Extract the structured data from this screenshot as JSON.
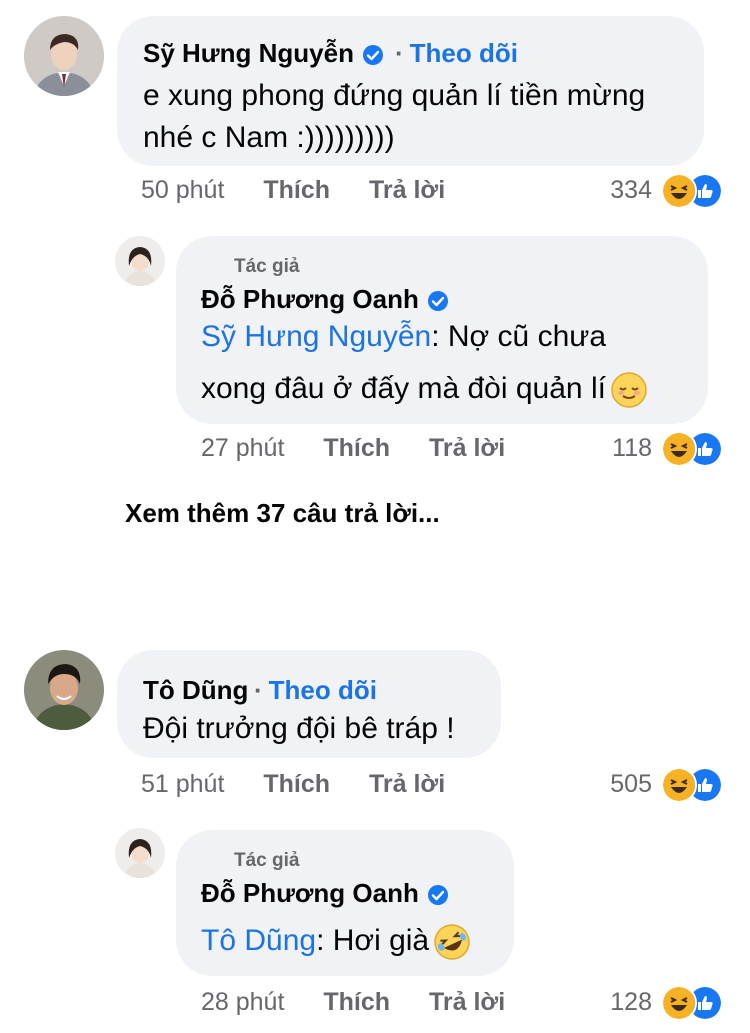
{
  "comments": [
    {
      "author": "Sỹ Hưng Nguyễn",
      "follow": "Theo dõi",
      "text_line1": "e xung phong đứng quản lí tiền mừng",
      "text_line2": "nhé c Nam :)))))))))",
      "time": "50 phút",
      "like": "Thích",
      "reply": "Trả lời",
      "count": "334"
    },
    {
      "tag": "Tác giả",
      "author": "Đỗ Phương Oanh",
      "mention": "Sỹ Hưng Nguyễn",
      "text_line1": ": Nợ cũ chưa",
      "text_line2": "xong đâu ở đấy mà đòi quản lí",
      "time": "27 phút",
      "like": "Thích",
      "reply": "Trả lời",
      "count": "118"
    },
    {
      "author": "Tô Dũng",
      "follow": "Theo dõi",
      "text_line1": "Đội trưởng đội bê tráp !",
      "time": "51 phút",
      "like": "Thích",
      "reply": "Trả lời",
      "count": "505"
    },
    {
      "tag": "Tác giả",
      "author": "Đỗ Phương Oanh",
      "mention": "Tô Dũng",
      "text_line1": ": Hơi già",
      "time": "28 phút",
      "like": "Thích",
      "reply": "Trả lời",
      "count": "128"
    }
  ],
  "see_more": "Xem thêm 37 câu trả lời...",
  "colors": {
    "bubble": "#f0f2f5",
    "link": "#1b74e4",
    "meta": "#65676b",
    "like_blue": "#1877f2",
    "haha_yellow": "#f7b125"
  },
  "icons": [
    "verified-badge-icon",
    "haha-reaction-icon",
    "like-reaction-icon",
    "relieved-emoji-icon",
    "rofl-emoji-icon"
  ]
}
